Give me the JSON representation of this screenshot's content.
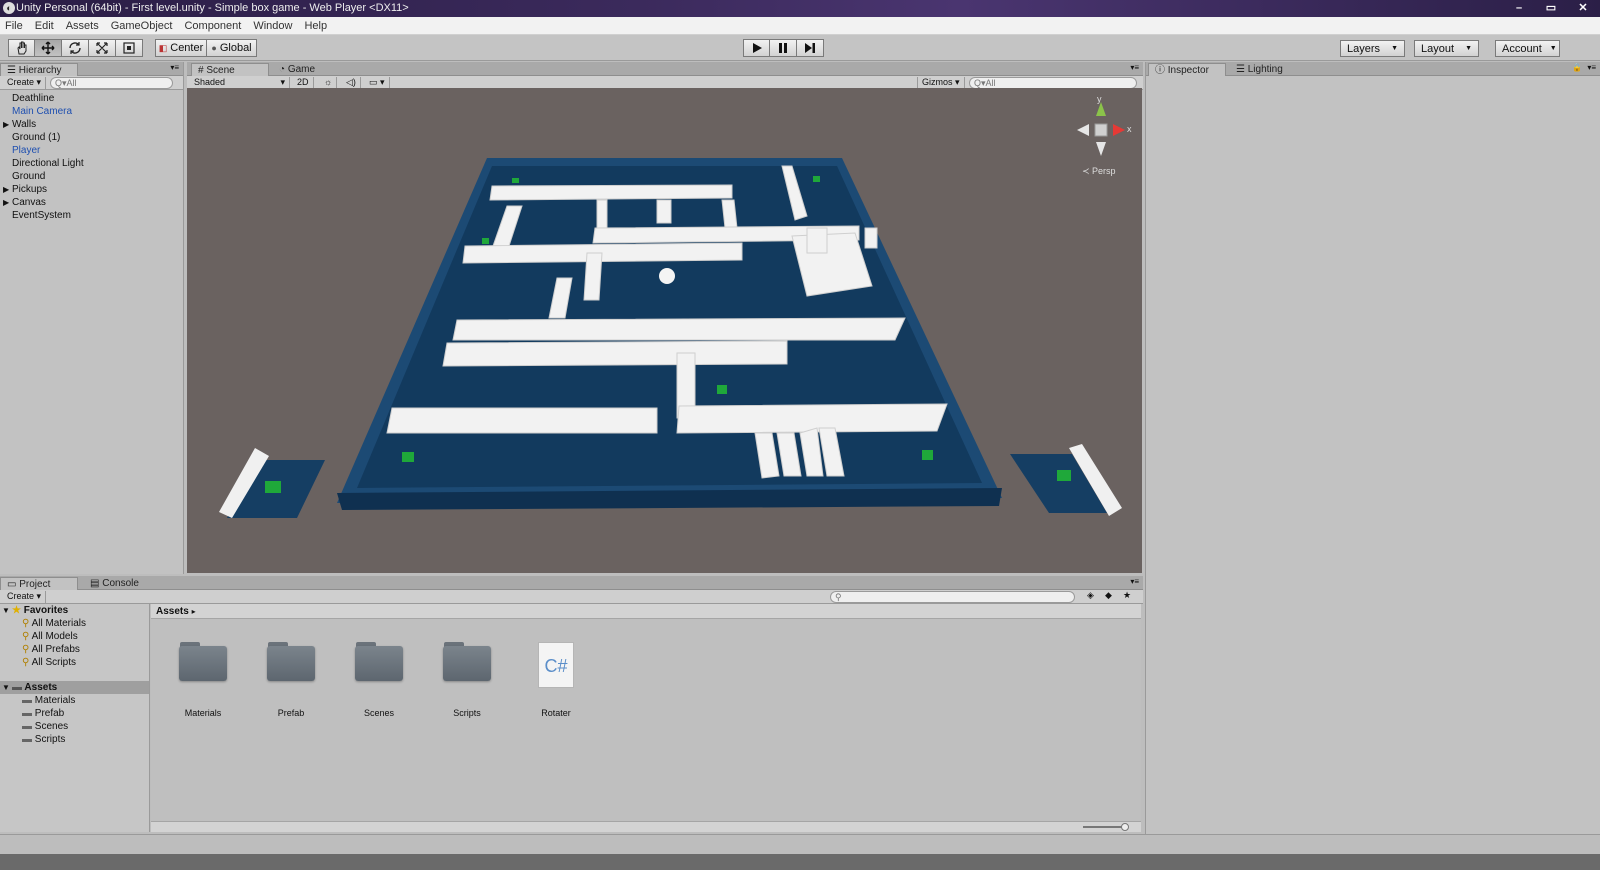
{
  "window": {
    "title": "Unity Personal (64bit) - First level.unity - Simple box game - Web Player <DX11>",
    "controls": [
      "–",
      "▭",
      "✕"
    ]
  },
  "menu": [
    "File",
    "Edit",
    "Assets",
    "GameObject",
    "Component",
    "Window",
    "Help"
  ],
  "toolbar": {
    "pivot_label": "Center",
    "space_label": "Global",
    "layers_label": "Layers",
    "layout_label": "Layout",
    "account_label": "Account"
  },
  "hierarchy": {
    "tab": "Hierarchy",
    "create_label": "Create",
    "search_placeholder": "Q▾All",
    "items": [
      {
        "name": "Deathline",
        "expandable": false,
        "highlight": false
      },
      {
        "name": "Main Camera",
        "expandable": false,
        "highlight": true
      },
      {
        "name": "Walls",
        "expandable": true,
        "highlight": false
      },
      {
        "name": "Ground (1)",
        "expandable": false,
        "highlight": false
      },
      {
        "name": "Player",
        "expandable": false,
        "highlight": true
      },
      {
        "name": "Directional Light",
        "expandable": false,
        "highlight": false
      },
      {
        "name": "Ground",
        "expandable": false,
        "highlight": false
      },
      {
        "name": "Pickups",
        "expandable": true,
        "highlight": false
      },
      {
        "name": "Canvas",
        "expandable": true,
        "highlight": false
      },
      {
        "name": "EventSystem",
        "expandable": false,
        "highlight": false
      }
    ]
  },
  "scene": {
    "tab_scene": "Scene",
    "tab_game": "Game",
    "shading": "Shaded",
    "mode_2d": "2D",
    "gizmos_label": "Gizmos",
    "search_placeholder": "Q▾All",
    "persp_label": "Persp",
    "axis_y": "y",
    "axis_x": "x"
  },
  "project": {
    "tab_project": "Project",
    "tab_console": "Console",
    "create_label": "Create",
    "favorites_label": "Favorites",
    "favorites": [
      "All Materials",
      "All Models",
      "All Prefabs",
      "All Scripts"
    ],
    "assets_label": "Assets",
    "asset_folders": [
      "Materials",
      "Prefab",
      "Scenes",
      "Scripts"
    ],
    "breadcrumb": "Assets",
    "assets": [
      {
        "name": "Materials",
        "type": "folder"
      },
      {
        "name": "Prefab",
        "type": "folder"
      },
      {
        "name": "Scenes",
        "type": "folder"
      },
      {
        "name": "Scripts",
        "type": "folder"
      },
      {
        "name": "Rotater",
        "type": "script"
      }
    ],
    "script_glyph": "C#"
  },
  "inspector": {
    "tab_inspector": "Inspector",
    "tab_lighting": "Lighting"
  },
  "colors": {
    "scene_bg": "#6a6260",
    "board": "#153e63",
    "board_rim": "#1e4e7a",
    "walls": "#f0f0f0",
    "pickups": "#1fa83a"
  }
}
